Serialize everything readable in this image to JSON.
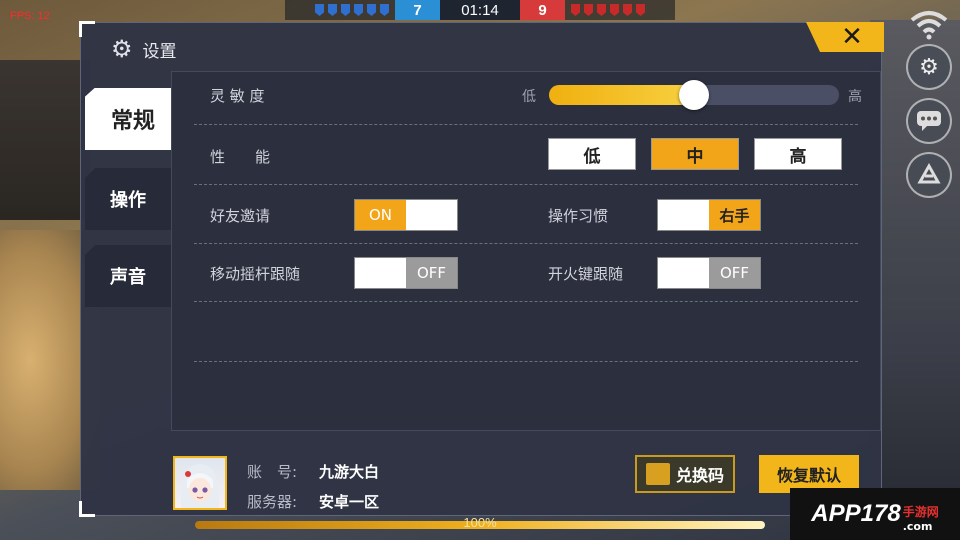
{
  "hud": {
    "fps": "FPS: 12",
    "blue_score": "7",
    "timer": "01:14",
    "red_score": "9",
    "progress_label": "100%",
    "progress_value": 1.0
  },
  "dialog": {
    "title": "设置",
    "close_icon": "close-x-icon",
    "tabs": [
      {
        "label": "常规",
        "active": true
      },
      {
        "label": "操作",
        "active": false
      },
      {
        "label": "声音",
        "active": false
      }
    ],
    "sensitivity": {
      "label": "灵 敏 度",
      "low": "低",
      "high": "高",
      "value": 0.5
    },
    "performance": {
      "label": "性　　能",
      "options": [
        "低",
        "中",
        "高"
      ],
      "selected": "中"
    },
    "friend_invite": {
      "label": "好友邀请",
      "on_text": "ON",
      "state": true
    },
    "control_habit": {
      "label": "操作习惯",
      "value": "右手"
    },
    "joystick_follow": {
      "label": "移动摇杆跟随",
      "off_text": "OFF",
      "state": false
    },
    "fire_follow": {
      "label": "开火键跟随",
      "off_text": "OFF",
      "state": false
    }
  },
  "account": {
    "account_label": "账　号:",
    "account_value": "九游大白",
    "server_label": "服务器:",
    "server_value": "安卓一区",
    "redeem_label": "兑换码",
    "restore_label": "恢复默认"
  },
  "watermark": {
    "brand": "APP178",
    "sub": "手游网",
    "domain": ".com"
  },
  "colors": {
    "accent": "#f3b61a",
    "panel": "#2c2f3e",
    "blue_team": "#2b8fd6",
    "red_team": "#d63a3a"
  }
}
